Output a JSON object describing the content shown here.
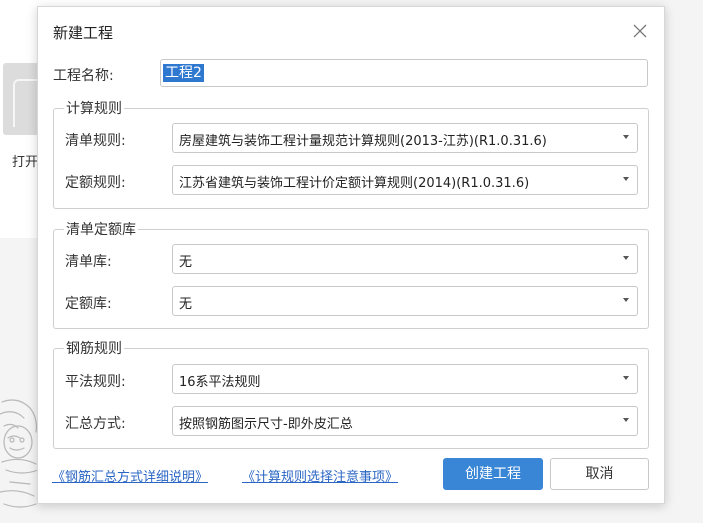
{
  "background": {
    "open_label": "打开"
  },
  "dialog": {
    "title": "新建工程",
    "close_icon": "close-icon",
    "project_name": {
      "label": "工程名称:",
      "value": "工程2"
    },
    "groups": {
      "calc_rules": {
        "title": "计算规则",
        "rows": [
          {
            "label": "清单规则:",
            "value": "房屋建筑与装饰工程计量规范计算规则(2013-江苏)(R1.0.31.6)"
          },
          {
            "label": "定额规则:",
            "value": "江苏省建筑与装饰工程计价定额计算规则(2014)(R1.0.31.6)"
          }
        ]
      },
      "quota_library": {
        "title": "清单定额库",
        "rows": [
          {
            "label": "清单库:",
            "value": "无"
          },
          {
            "label": "定额库:",
            "value": "无"
          }
        ]
      },
      "rebar_rules": {
        "title": "钢筋规则",
        "rows": [
          {
            "label": "平法规则:",
            "value": "16系平法规则"
          },
          {
            "label": "汇总方式:",
            "value": "按照钢筋图示尺寸-即外皮汇总"
          }
        ]
      }
    },
    "links": {
      "rebar_summary_help": "《钢筋汇总方式详细说明》",
      "calc_rule_notes": "《计算规则选择注意事项》"
    },
    "buttons": {
      "create": "创建工程",
      "cancel": "取消"
    }
  },
  "colors": {
    "accent": "#3a86d6",
    "link": "#2a66c4",
    "selection": "#2f78d0"
  }
}
